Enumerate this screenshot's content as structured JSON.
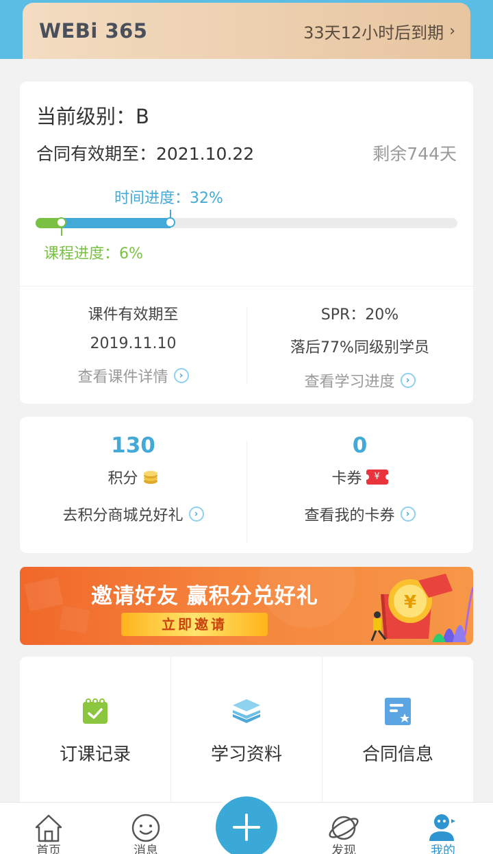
{
  "membership": {
    "brand": "WEBi 365",
    "expiry_text": "33天12小时后到期",
    "chevron": "›"
  },
  "level_card": {
    "level_text": "当前级别：B",
    "contract_text": "合同有效期至：2021.10.22",
    "remaining_text": "剩余744天",
    "time_progress_label": "时间进度：32%",
    "time_progress": 0.32,
    "course_progress_label": "课程进度：6%",
    "course_progress": 0.06,
    "courseware": {
      "title": "课件有效期至",
      "date": "2019.11.10",
      "link": "查看课件详情"
    },
    "spr": {
      "title": "SPR：20%",
      "behind": "落后77%同级别学员",
      "link": "查看学习进度"
    }
  },
  "points_card": {
    "points_value": "130",
    "points_label": "积分",
    "points_link": "去积分商城兑好礼",
    "coupons_value": "0",
    "coupons_label": "卡券",
    "coupons_link": "查看我的卡券",
    "coupon_symbol": "¥"
  },
  "banner": {
    "title": "邀请好友  赢积分兑好礼",
    "button": "立即邀请"
  },
  "grid": [
    {
      "label": "订课记录",
      "icon": "calendar-check-icon"
    },
    {
      "label": "学习资料",
      "icon": "layers-icon"
    },
    {
      "label": "合同信息",
      "icon": "contract-doc-icon"
    }
  ],
  "nav": {
    "items": [
      {
        "label": "首页",
        "icon": "home-icon"
      },
      {
        "label": "消息",
        "icon": "smiley-message-icon"
      },
      {
        "label": "发现",
        "icon": "planet-icon"
      },
      {
        "label": "我的",
        "icon": "user-icon"
      }
    ],
    "active_index": 3
  },
  "colors": {
    "accent_blue": "#43a9d6",
    "progress_green": "#7ac143",
    "banner_orange": "#f0682a",
    "top_strip": "#5bbde4"
  }
}
